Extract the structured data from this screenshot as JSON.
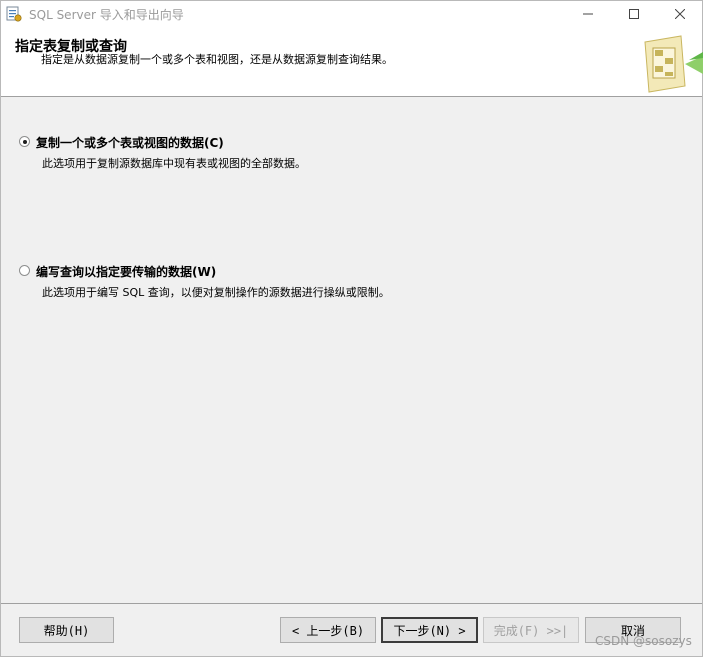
{
  "window": {
    "title": "SQL Server 导入和导出向导"
  },
  "header": {
    "title": "指定表复制或查询",
    "subtitle": "指定是从数据源复制一个或多个表和视图，还是从数据源复制查询结果。"
  },
  "options": [
    {
      "label": "复制一个或多个表或视图的数据(C)",
      "description": "此选项用于复制源数据库中现有表或视图的全部数据。",
      "selected": true
    },
    {
      "label": "编写查询以指定要传输的数据(W)",
      "description": "此选项用于编写 SQL 查询，以便对复制操作的源数据进行操纵或限制。",
      "selected": false
    }
  ],
  "footer": {
    "help": "帮助(H)",
    "back": "< 上一步(B)",
    "next": "下一步(N) >",
    "finish": "完成(F) >>|",
    "cancel": "取消",
    "watermark": "CSDN @sosozys"
  },
  "icons": {
    "app": "sql-server-wizard-icon",
    "minimize": "minimize-icon",
    "maximize": "maximize-icon",
    "close": "close-icon",
    "header": "wizard-table-icon"
  },
  "colors": {
    "panel": "#f0f0f0",
    "header": "#ffffff",
    "button": "#e1e1e1",
    "disabled_text": "#a0a0a0"
  }
}
